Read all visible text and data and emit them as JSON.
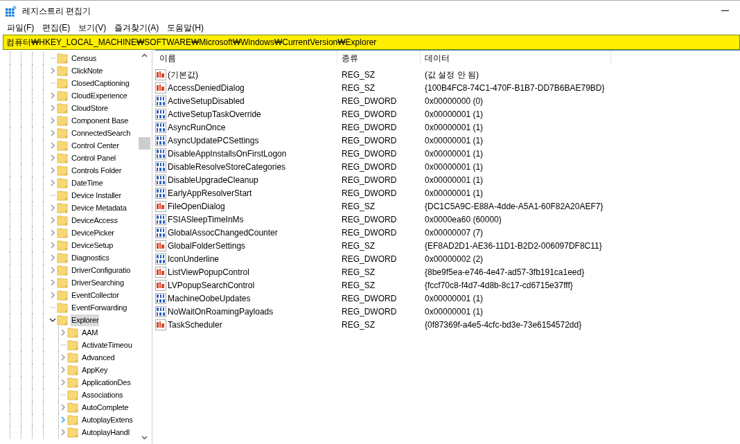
{
  "window": {
    "title": "레지스트리 편집기"
  },
  "menu": [
    "파일(F)",
    "편집(E)",
    "보기(V)",
    "즐겨찾기(A)",
    "도움말(H)"
  ],
  "address": "컴퓨터₩HKEY_LOCAL_MACHINE₩SOFTWARE₩Microsoft₩Windows₩CurrentVersion₩Explorer",
  "tree": [
    {
      "label": "Census",
      "kind": "leaf",
      "selected": false
    },
    {
      "label": "ClickNote",
      "kind": "collapsed",
      "selected": false
    },
    {
      "label": "ClosedCaptioning",
      "kind": "leaf",
      "selected": false
    },
    {
      "label": "CloudExperience",
      "kind": "collapsed",
      "selected": false
    },
    {
      "label": "CloudStore",
      "kind": "collapsed",
      "selected": false
    },
    {
      "label": "Component Base",
      "kind": "collapsed",
      "selected": false
    },
    {
      "label": "ConnectedSearch",
      "kind": "collapsed",
      "selected": false
    },
    {
      "label": "Control Center",
      "kind": "collapsed",
      "selected": false
    },
    {
      "label": "Control Panel",
      "kind": "collapsed",
      "selected": false
    },
    {
      "label": "Controls Folder",
      "kind": "collapsed",
      "selected": false
    },
    {
      "label": "DateTime",
      "kind": "collapsed",
      "selected": false
    },
    {
      "label": "Device Installer",
      "kind": "leaf",
      "selected": false
    },
    {
      "label": "Device Metadata",
      "kind": "collapsed",
      "selected": false
    },
    {
      "label": "DeviceAccess",
      "kind": "collapsed",
      "selected": false
    },
    {
      "label": "DevicePicker",
      "kind": "collapsed",
      "selected": false
    },
    {
      "label": "DeviceSetup",
      "kind": "collapsed",
      "selected": false
    },
    {
      "label": "Diagnostics",
      "kind": "collapsed",
      "selected": false
    },
    {
      "label": "DriverConfiguratio",
      "kind": "collapsed",
      "selected": false
    },
    {
      "label": "DriverSearching",
      "kind": "collapsed",
      "selected": false
    },
    {
      "label": "EventCollector",
      "kind": "collapsed",
      "selected": false
    },
    {
      "label": "EventForwarding",
      "kind": "leaf",
      "selected": false
    },
    {
      "label": "Explorer",
      "kind": "expanded",
      "selected": true,
      "children": [
        {
          "label": "AAM",
          "kind": "collapsed",
          "selected": false
        },
        {
          "label": "ActivateTimeou",
          "kind": "leaf",
          "selected": false
        },
        {
          "label": "Advanced",
          "kind": "collapsed",
          "selected": false
        },
        {
          "label": "AppKey",
          "kind": "collapsed",
          "selected": false
        },
        {
          "label": "ApplicationDes",
          "kind": "collapsed",
          "selected": false
        },
        {
          "label": "Associations",
          "kind": "leaf",
          "selected": false
        },
        {
          "label": "AutoComplete",
          "kind": "collapsed",
          "selected": false
        },
        {
          "label": "AutoplayExtens",
          "kind": "collapsed",
          "selected": false,
          "hovered": true
        },
        {
          "label": "AutoplayHandl",
          "kind": "collapsed",
          "selected": false
        }
      ]
    }
  ],
  "table": {
    "columns": [
      "이름",
      "종류",
      "데이터"
    ],
    "rows": [
      {
        "name": "(기본값)",
        "kind": "sz",
        "type": "REG_SZ",
        "data": "(값 설정 안 됨)"
      },
      {
        "name": "AccessDeniedDialog",
        "kind": "sz",
        "type": "REG_SZ",
        "data": "{100B4FC8-74C1-470F-B1B7-DD7B6BAE79BD}"
      },
      {
        "name": "ActiveSetupDisabled",
        "kind": "dword",
        "type": "REG_DWORD",
        "data": "0x00000000 (0)"
      },
      {
        "name": "ActiveSetupTaskOverride",
        "kind": "dword",
        "type": "REG_DWORD",
        "data": "0x00000001 (1)"
      },
      {
        "name": "AsyncRunOnce",
        "kind": "dword",
        "type": "REG_DWORD",
        "data": "0x00000001 (1)"
      },
      {
        "name": "AsyncUpdatePCSettings",
        "kind": "dword",
        "type": "REG_DWORD",
        "data": "0x00000001 (1)"
      },
      {
        "name": "DisableAppInstallsOnFirstLogon",
        "kind": "dword",
        "type": "REG_DWORD",
        "data": "0x00000001 (1)"
      },
      {
        "name": "DisableResolveStoreCategories",
        "kind": "dword",
        "type": "REG_DWORD",
        "data": "0x00000001 (1)"
      },
      {
        "name": "DisableUpgradeCleanup",
        "kind": "dword",
        "type": "REG_DWORD",
        "data": "0x00000001 (1)"
      },
      {
        "name": "EarlyAppResolverStart",
        "kind": "dword",
        "type": "REG_DWORD",
        "data": "0x00000001 (1)"
      },
      {
        "name": "FileOpenDialog",
        "kind": "sz",
        "type": "REG_SZ",
        "data": "{DC1C5A9C-E88A-4dde-A5A1-60F82A20AEF7}"
      },
      {
        "name": "FSIASleepTimeInMs",
        "kind": "dword",
        "type": "REG_DWORD",
        "data": "0x0000ea60 (60000)"
      },
      {
        "name": "GlobalAssocChangedCounter",
        "kind": "dword",
        "type": "REG_DWORD",
        "data": "0x00000007 (7)"
      },
      {
        "name": "GlobalFolderSettings",
        "kind": "sz",
        "type": "REG_SZ",
        "data": "{EF8AD2D1-AE36-11D1-B2D2-006097DF8C11}"
      },
      {
        "name": "IconUnderline",
        "kind": "dword",
        "type": "REG_DWORD",
        "data": "0x00000002 (2)"
      },
      {
        "name": "ListViewPopupControl",
        "kind": "sz",
        "type": "REG_SZ",
        "data": "{8be9f5ea-e746-4e47-ad57-3fb191ca1eed}"
      },
      {
        "name": "LVPopupSearchControl",
        "kind": "sz",
        "type": "REG_SZ",
        "data": "{fccf70c8-f4d7-4d8b-8c17-cd6715e37fff}"
      },
      {
        "name": "MachineOobeUpdates",
        "kind": "dword",
        "type": "REG_DWORD",
        "data": "0x00000001 (1)"
      },
      {
        "name": "NoWaitOnRoamingPayloads",
        "kind": "dword",
        "type": "REG_DWORD",
        "data": "0x00000001 (1)"
      },
      {
        "name": "TaskScheduler",
        "kind": "sz",
        "type": "REG_SZ",
        "data": "{0f87369f-a4e5-4cfc-bd3e-73e6154572dd}"
      }
    ]
  }
}
